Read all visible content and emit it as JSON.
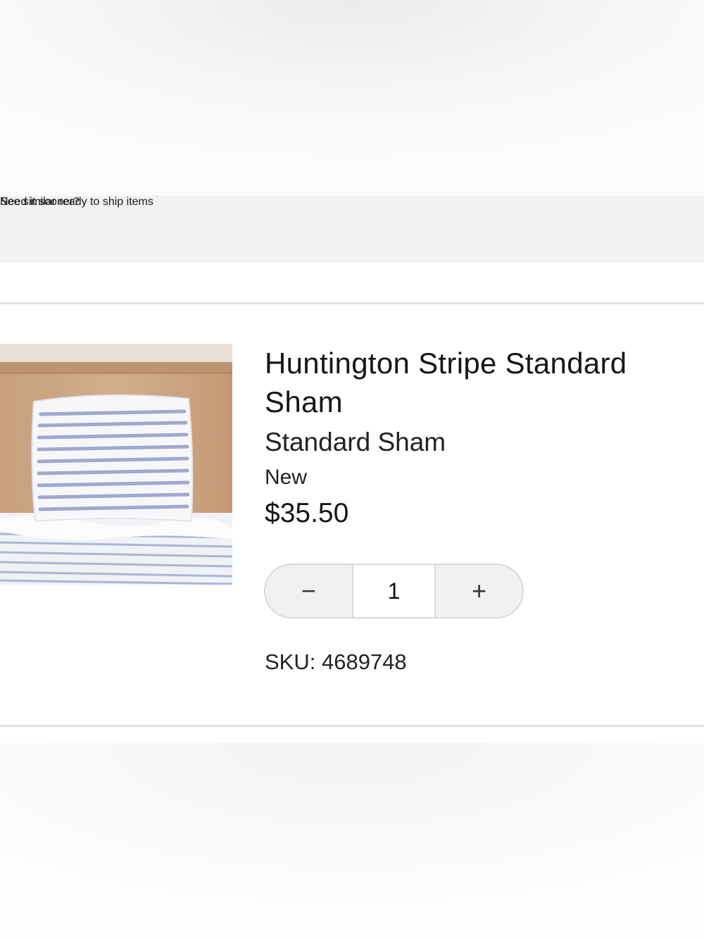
{
  "banner": {
    "prompt": "Need it sooner?",
    "link": "See similar ready to ship items"
  },
  "product": {
    "title": "Huntington Stripe Standard Sham",
    "variant": "Standard Sham",
    "condition": "New",
    "price": "$35.50",
    "sku": "SKU: 4689748",
    "image_alt": "Huntington Stripe Standard Sham on bed"
  },
  "quantity": {
    "decrement": "−",
    "value": "1",
    "increment": "+"
  },
  "colors": {
    "banner_bg": "#f2f2f2",
    "divider": "#e2e2e2",
    "stripe": "#8f9cc9"
  },
  "icons": {
    "decrement": "minus-icon",
    "increment": "plus-icon"
  }
}
